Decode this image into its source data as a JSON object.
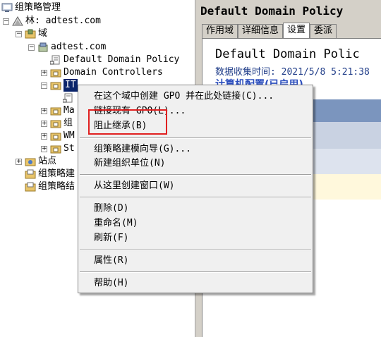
{
  "tree": {
    "root": "组策略管理",
    "forest": "林: adtest.com",
    "domains": "域",
    "domain": "adtest.com",
    "default_policy": "Default Domain Policy",
    "domain_controllers": "Domain Controllers",
    "ou_it": "IT",
    "ou_ma": "Ma",
    "ou_zu": "组",
    "ou_wm": "WM",
    "ou_st": "St",
    "sites": "站点",
    "gp_modeling": "组策略建",
    "gp_results": "组策略结"
  },
  "right": {
    "title": "Default Domain Policy",
    "tabs": [
      "作用域",
      "详细信息",
      "设置",
      "委派"
    ],
    "active_tab": "设置",
    "content_title": "Default Domain Polic",
    "collection_time": "数据收集时间: 2021/5/8 5:21:38",
    "computer_config": "计算机配置(已启用)"
  },
  "context_menu": {
    "items": [
      "在这个域中创建 GPO 并在此处链接(C)...",
      "链接现有 GPO(L)...",
      "阻止继承(B)",
      "组策略建模向导(G)...",
      "新建组织单位(N)",
      "从这里创建窗口(W)",
      "删除(D)",
      "重命名(M)",
      "刷新(F)",
      "属性(R)",
      "帮助(H)"
    ]
  },
  "colors": {
    "selection": "#0a246a",
    "highlight_box": "#e02020",
    "band_blue": "#7b95be",
    "link_blue": "#2a4dbd"
  }
}
